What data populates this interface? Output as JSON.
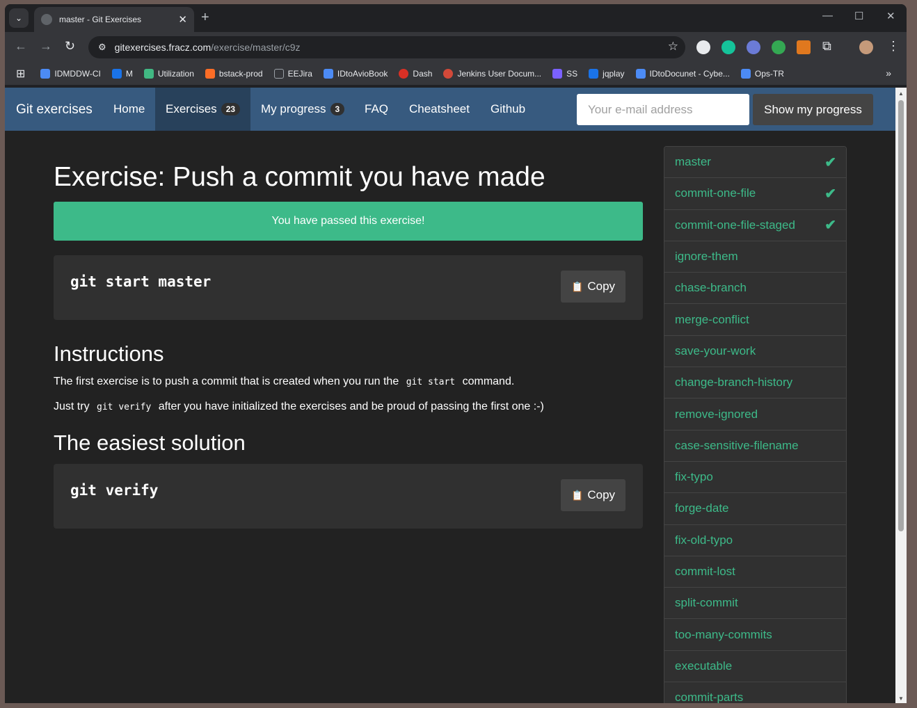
{
  "browser": {
    "tab_title": "master - Git Exercises",
    "url_host": "gitexercises.fracz.com",
    "url_path": "/exercise/master/c9z",
    "bookmarks": [
      {
        "label": "IDMDDW-CI",
        "icon": "jira-icon",
        "color": "#4c8bf5"
      },
      {
        "label": "M",
        "icon": "outlook-icon",
        "color": "#1a73e8"
      },
      {
        "label": "Utilization",
        "icon": "vue-icon",
        "color": "#41b883"
      },
      {
        "label": "bstack-prod",
        "icon": "gitlab-icon",
        "color": "#fc6d26"
      },
      {
        "label": "EEJira",
        "icon": "folder-icon",
        "color": "#9aa0a6"
      },
      {
        "label": "IDtoAvioBook",
        "icon": "jira-icon",
        "color": "#4c8bf5"
      },
      {
        "label": "Dash",
        "icon": "dash-icon",
        "color": "#d93025"
      },
      {
        "label": "Jenkins User Docum...",
        "icon": "jenkins-icon",
        "color": "#d24939"
      },
      {
        "label": "SS",
        "icon": "triangle-icon",
        "color": "#7b61ff"
      },
      {
        "label": "jqplay",
        "icon": "play-icon",
        "color": "#1a73e8"
      },
      {
        "label": "IDtoDocunet - Cybe...",
        "icon": "jira-icon",
        "color": "#4c8bf5"
      },
      {
        "label": "Ops-TR",
        "icon": "jira-icon",
        "color": "#4c8bf5"
      }
    ]
  },
  "navbar": {
    "brand": "Git exercises",
    "home": "Home",
    "exercises": "Exercises",
    "exercises_count": "23",
    "my_progress": "My progress",
    "progress_count": "3",
    "faq": "FAQ",
    "cheatsheet": "Cheatsheet",
    "github": "Github",
    "email_placeholder": "Your e-mail address",
    "show_progress": "Show my progress"
  },
  "main": {
    "title": "Exercise: Push a commit you have made",
    "alert": "You have passed this exercise!",
    "start_command": "git start master",
    "copy_label": "Copy",
    "instructions_heading": "Instructions",
    "p1_before": "The first exercise is to push a commit that is created when you run the",
    "p1_code": "git start",
    "p1_after": "command.",
    "p2_before": "Just try",
    "p2_code": "git verify",
    "p2_after": "after you have initialized the exercises and be proud of passing the first one :-)",
    "solution_heading": "The easiest solution",
    "solution_command": "git verify"
  },
  "sidebar": {
    "items": [
      {
        "label": "master",
        "passed": true
      },
      {
        "label": "commit-one-file",
        "passed": true
      },
      {
        "label": "commit-one-file-staged",
        "passed": true
      },
      {
        "label": "ignore-them",
        "passed": false
      },
      {
        "label": "chase-branch",
        "passed": false
      },
      {
        "label": "merge-conflict",
        "passed": false
      },
      {
        "label": "save-your-work",
        "passed": false
      },
      {
        "label": "change-branch-history",
        "passed": false
      },
      {
        "label": "remove-ignored",
        "passed": false
      },
      {
        "label": "case-sensitive-filename",
        "passed": false
      },
      {
        "label": "fix-typo",
        "passed": false
      },
      {
        "label": "forge-date",
        "passed": false
      },
      {
        "label": "fix-old-typo",
        "passed": false
      },
      {
        "label": "commit-lost",
        "passed": false
      },
      {
        "label": "split-commit",
        "passed": false
      },
      {
        "label": "too-many-commits",
        "passed": false
      },
      {
        "label": "executable",
        "passed": false
      },
      {
        "label": "commit-parts",
        "passed": false
      }
    ]
  },
  "colors": {
    "navbar": "#375a7f",
    "success": "#3dba89",
    "background": "#222222"
  }
}
